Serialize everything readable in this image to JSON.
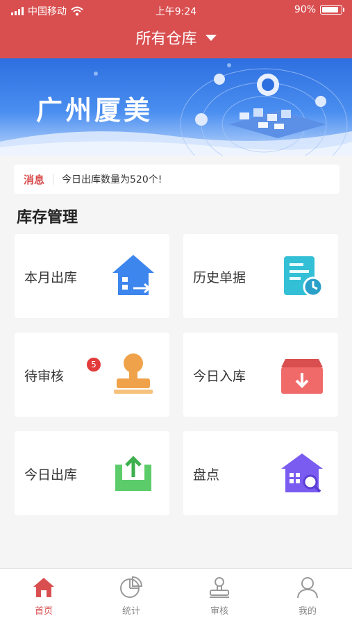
{
  "status_bar": {
    "carrier": "中国移动",
    "time": "上午9:24",
    "battery": "90%",
    "battery_level": 0.9,
    "icons": [
      "signal-icon",
      "wifi-icon",
      "battery-icon"
    ]
  },
  "header": {
    "title": "所有仓库",
    "dropdown_icon": "caret-down-icon",
    "color": "#d94f50"
  },
  "banner": {
    "brand": "广州厦美"
  },
  "notice": {
    "tag": "消息",
    "message": "今日出库数量为520个!"
  },
  "section": {
    "title": "库存管理"
  },
  "cards": [
    {
      "label": "本月出库",
      "icon": "house-export-icon",
      "color": "#3d86ee"
    },
    {
      "label": "历史单据",
      "icon": "document-clock-icon",
      "color": "#33c0d6"
    },
    {
      "label": "待审核",
      "icon": "stamp-icon",
      "badge": "5",
      "color": "#f0a24a"
    },
    {
      "label": "今日入库",
      "icon": "inbox-download-icon",
      "color": "#f06a6a"
    },
    {
      "label": "今日出库",
      "icon": "tray-upload-icon",
      "color": "#5ccc6a"
    },
    {
      "label": "盘点",
      "icon": "warehouse-search-icon",
      "color": "#7a5cf0"
    }
  ],
  "tabbar": {
    "tabs": [
      {
        "label": "首页",
        "icon": "home-icon",
        "active": true
      },
      {
        "label": "统计",
        "icon": "pie-chart-icon",
        "active": false
      },
      {
        "label": "审核",
        "icon": "stamp-icon",
        "active": false
      },
      {
        "label": "我的",
        "icon": "user-icon",
        "active": false
      }
    ],
    "active_color": "#d94f50"
  }
}
